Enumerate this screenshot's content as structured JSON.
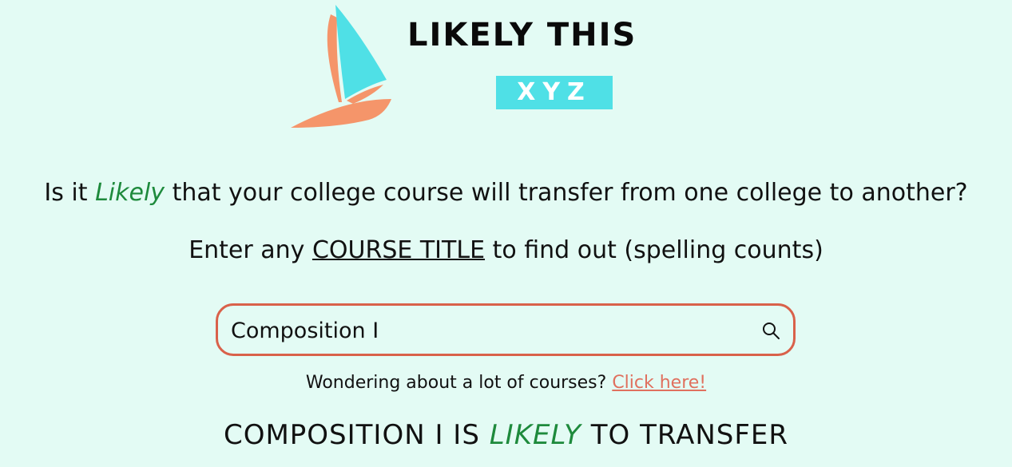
{
  "brand": {
    "title": "LIKELY THIS",
    "subtitle": "XYZ",
    "logo_icon": "sailboat-icon",
    "colors": {
      "sail": "#4fe0e6",
      "hull": "#f5956a",
      "subtitle_bg": "#4fe0e6"
    }
  },
  "question": {
    "prefix": "Is it ",
    "likely": "Likely",
    "suffix": " that your college course will transfer from one college to another?"
  },
  "instruction": {
    "prefix": "Enter any ",
    "course_title": "COURSE TITLE",
    "suffix": " to find out (spelling counts)"
  },
  "search": {
    "value": "Composition I",
    "icon": "search-icon",
    "border_color": "#d9614a"
  },
  "bulk": {
    "text": "Wondering about a lot of courses? ",
    "link_label": "Click here!",
    "link_color": "#e0705e"
  },
  "result": {
    "prefix": "COMPOSITION I IS ",
    "likely": "LIKELY",
    "suffix": " TO TRANSFER"
  },
  "accent_color": "#1e8a3c",
  "background": "#e3fbf4"
}
